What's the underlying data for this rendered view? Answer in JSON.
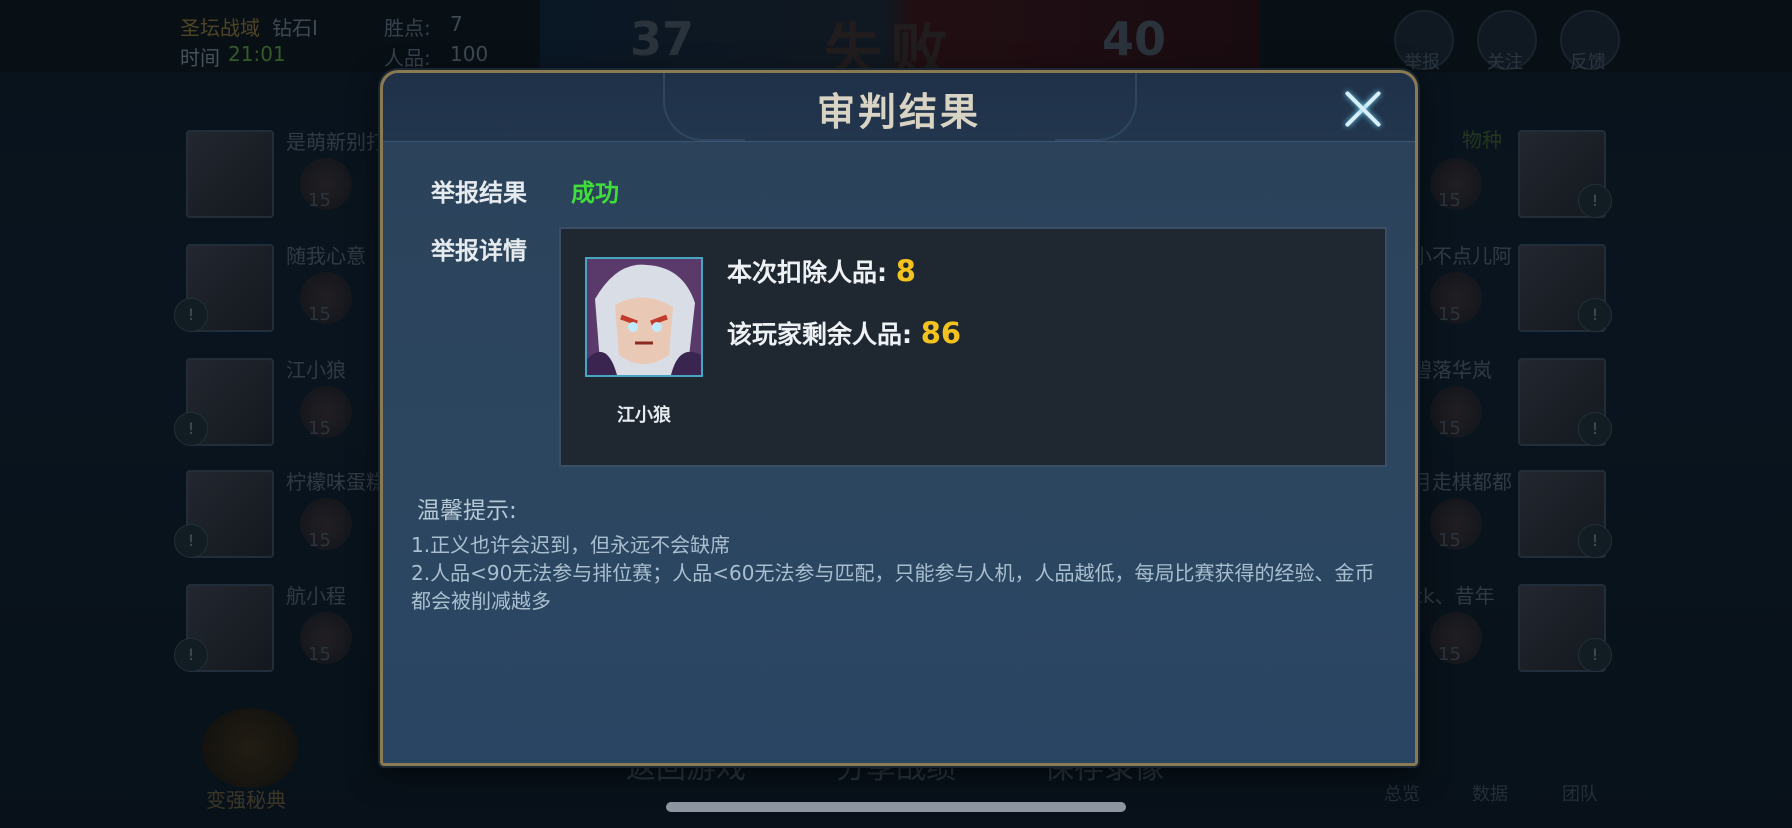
{
  "header": {
    "mode": "圣坛战域",
    "rank": "钻石I",
    "time_label": "时间",
    "time_value": "21:01",
    "wins_label": "胜点:",
    "wins_value": "7",
    "reputation_label": "人品:",
    "reputation_value": "100",
    "left_score": "37",
    "right_score": "40",
    "result": "失败",
    "actions": [
      "举报",
      "关注",
      "反馈"
    ]
  },
  "left_team": [
    {
      "name": "是萌新别打",
      "level": "15"
    },
    {
      "name": "随我心意",
      "level": "15"
    },
    {
      "name": "江小狼",
      "level": "15"
    },
    {
      "name": "柠檬味蛋糕",
      "level": "15"
    },
    {
      "name": "航小程",
      "level": "15"
    }
  ],
  "right_team": [
    {
      "name": "",
      "level": "15"
    },
    {
      "name": "小不点儿阿",
      "level": "15"
    },
    {
      "name": "碧落华岚",
      "level": "15"
    },
    {
      "name": "月走棋都都",
      "level": "15"
    },
    {
      "name": "ck、昔年",
      "level": "15"
    }
  ],
  "right_team_tag": "物种",
  "bottom": {
    "buttons": [
      "返回游戏",
      "分享战绩",
      "保存录像"
    ],
    "guide_label": "变强秘典",
    "tabs": [
      "总览",
      "数据",
      "团队"
    ]
  },
  "modal": {
    "title": "审判结果",
    "report_result_label": "举报结果",
    "report_result_value": "成功",
    "report_detail_label": "举报详情",
    "player_name": "江小狼",
    "deducted_label": "本次扣除人品:",
    "deducted_value": "8",
    "remaining_label": "该玩家剩余人品:",
    "remaining_value": "86",
    "tips_title": "温馨提示:",
    "tips": [
      "1.正义也许会迟到，但永远不会缺席",
      "2.人品<90无法参与排位赛；人品<60无法参与匹配，只能参与人机，人品越低，每局比赛获得的经验、金币都会被削减越多"
    ]
  },
  "colors": {
    "success": "#3fde3a",
    "highlight_number": "#f4c21f",
    "frame_gold": "#8a7a52"
  }
}
